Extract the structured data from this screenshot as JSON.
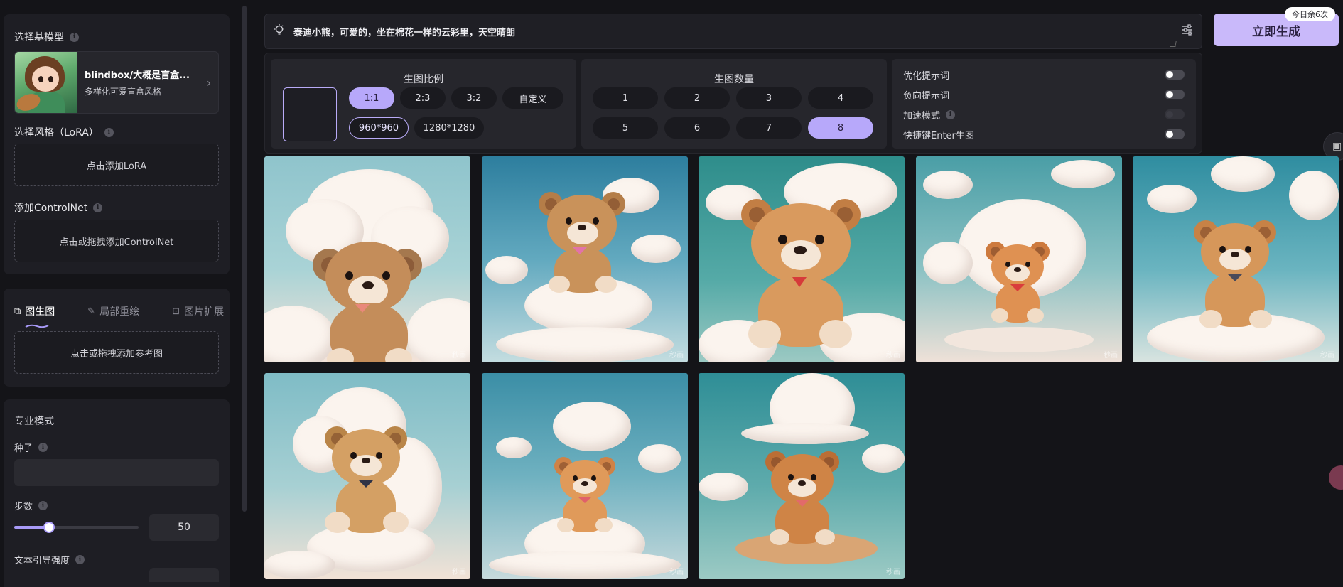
{
  "sidebar": {
    "base_model_title": "选择基模型",
    "model_name": "blindbox/大概是盲盒...",
    "model_desc": "多样化可爱盲盒风格",
    "lora_title": "选择风格（LoRA）",
    "lora_add": "点击添加LoRA",
    "controlnet_title": "添加ControlNet",
    "controlnet_add": "点击或拖拽添加ControlNet",
    "tabs": [
      {
        "label": "图生图",
        "icon": "image-to-image-icon"
      },
      {
        "label": "局部重绘",
        "icon": "brush-icon"
      },
      {
        "label": "图片扩展",
        "icon": "expand-image-icon"
      }
    ],
    "ref_add": "点击或拖拽添加参考图",
    "pro_mode": "专业模式",
    "seed_label": "种子",
    "steps_label": "步数",
    "steps_value": "50",
    "steps_fraction": 0.28,
    "cfg_label": "文本引导强度"
  },
  "prompt": {
    "text": "泰迪小熊，可爱的，坐在棉花一样的云彩里，天空晴朗",
    "generate_label": "立即生成",
    "quota": "今日余6次"
  },
  "settings": {
    "ratio_title": "生图比例",
    "ratios": [
      "1:1",
      "2:3",
      "3:2",
      "自定义"
    ],
    "selected_ratio": "1:1",
    "sizes": [
      "960*960",
      "1280*1280"
    ],
    "selected_size": "960*960",
    "count_title": "生图数量",
    "counts": [
      "1",
      "2",
      "3",
      "4",
      "5",
      "6",
      "7",
      "8"
    ],
    "selected_count": "8",
    "toggles": [
      {
        "label": "优化提示词",
        "on": false
      },
      {
        "label": "负向提示词",
        "on": false
      },
      {
        "label": "加速模式",
        "on": false,
        "disabled": true
      },
      {
        "label": "快捷键Enter生图",
        "on": false
      }
    ]
  },
  "gallery": {
    "watermark": "秒画",
    "count": 8
  },
  "colors": {
    "accent": "#b7a8fa",
    "generate_bg": "#c9b9fa",
    "bg": "#141418",
    "panel": "#1e1e24"
  }
}
